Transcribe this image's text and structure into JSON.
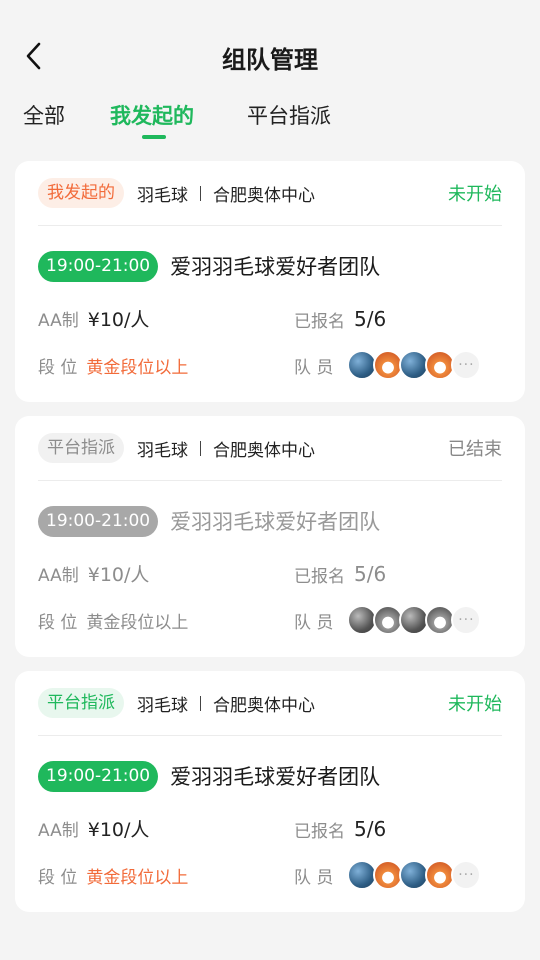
{
  "header": {
    "title": "组队管理"
  },
  "tabs": [
    {
      "label": "全部",
      "active": false
    },
    {
      "label": "我发起的",
      "active": true
    },
    {
      "label": "平台指派",
      "active": false
    }
  ],
  "colors": {
    "accent": "#1fb85c",
    "orange": "#f26b3a",
    "grey": "#8d8d8d"
  },
  "cards": [
    {
      "tag": "我发起的",
      "sport": "羽毛球",
      "venue": "合肥奥体中心",
      "status": "未开始",
      "time": "19:00-21:00",
      "team": "爱羽羽毛球爱好者团队",
      "fee_label": "AA制",
      "fee_value": "¥10/人",
      "signup_label": "已报名",
      "signup_value": "5/6",
      "rank_label": "段 位",
      "rank_value": "黄金段位以上",
      "members_label": "队 员",
      "more": "···",
      "avatars": [
        "blue-avatar-icon",
        "cat-avatar-icon",
        "blue-avatar-icon",
        "cat-avatar-icon"
      ]
    },
    {
      "tag": "平台指派",
      "sport": "羽毛球",
      "venue": "合肥奥体中心",
      "status": "已结束",
      "time": "19:00-21:00",
      "team": "爱羽羽毛球爱好者团队",
      "fee_label": "AA制",
      "fee_value": "¥10/人",
      "signup_label": "已报名",
      "signup_value": "5/6",
      "rank_label": "段 位",
      "rank_value": "黄金段位以上",
      "members_label": "队 员",
      "more": "···",
      "avatars": [
        "grey-avatar-icon",
        "grey-avatar-icon",
        "grey-avatar-icon",
        "grey-avatar-icon"
      ]
    },
    {
      "tag": "平台指派",
      "sport": "羽毛球",
      "venue": "合肥奥体中心",
      "status": "未开始",
      "time": "19:00-21:00",
      "team": "爱羽羽毛球爱好者团队",
      "fee_label": "AA制",
      "fee_value": "¥10/人",
      "signup_label": "已报名",
      "signup_value": "5/6",
      "rank_label": "段 位",
      "rank_value": "黄金段位以上",
      "members_label": "队 员",
      "more": "···",
      "avatars": [
        "blue-avatar-icon",
        "cat-avatar-icon",
        "blue-avatar-icon",
        "cat-avatar-icon"
      ]
    }
  ]
}
